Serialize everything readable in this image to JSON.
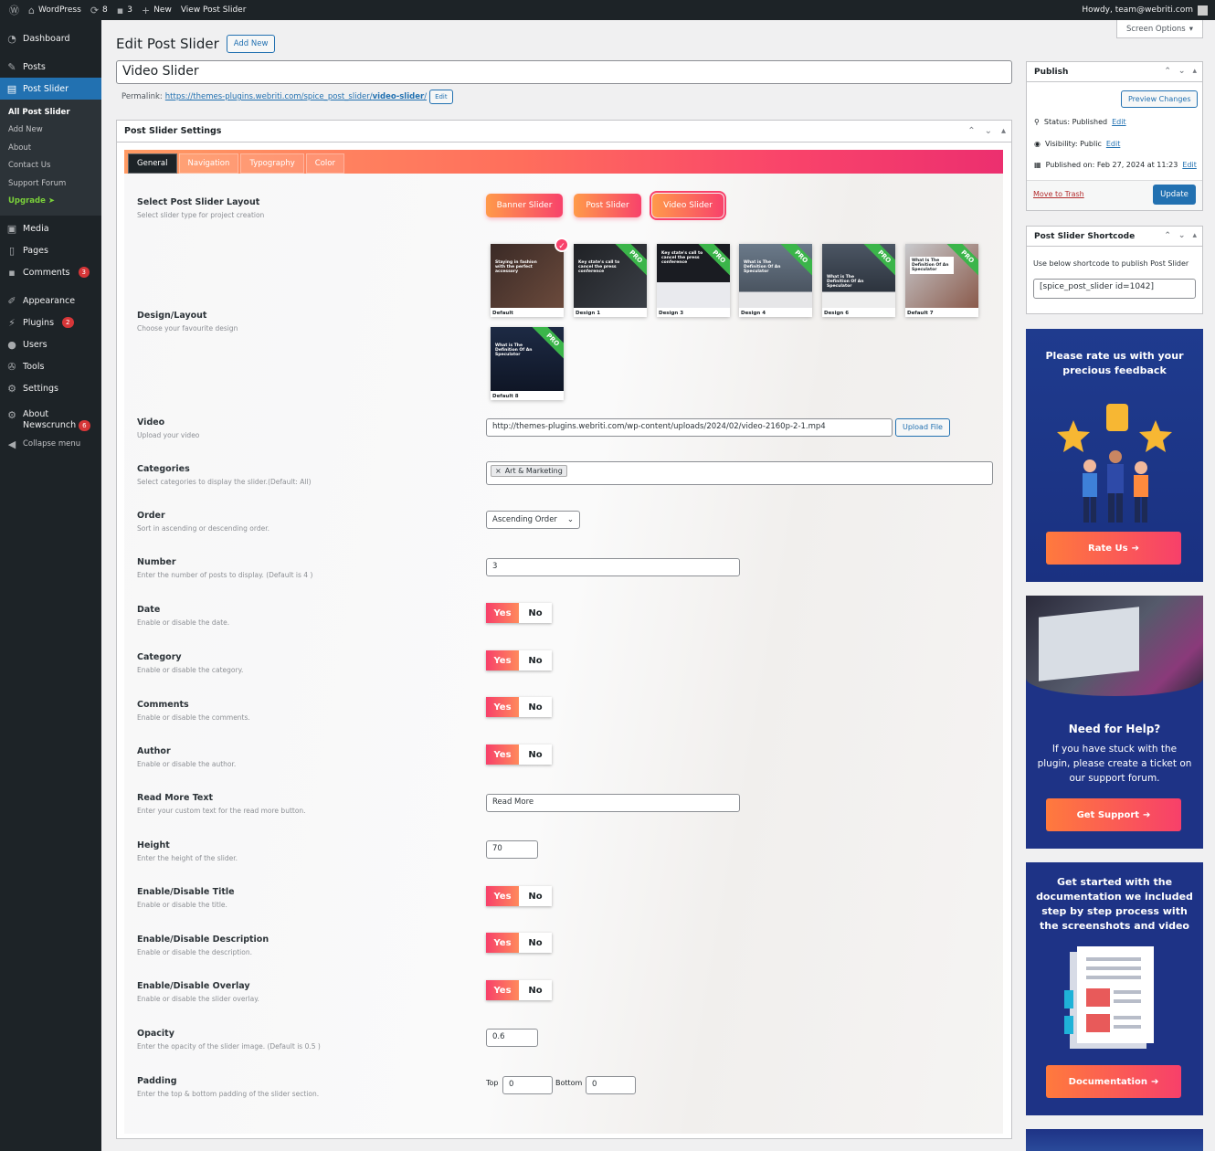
{
  "adminbar": {
    "site": "WordPress",
    "updates": "8",
    "comments": "3",
    "new": "New",
    "view": "View Post Slider",
    "howdy": "Howdy, team@webriti.com"
  },
  "sidebar": {
    "items": [
      {
        "label": "Dashboard",
        "icon": "dashboard-icon"
      },
      {
        "label": "Posts",
        "icon": "pin-icon"
      },
      {
        "label": "Post Slider",
        "icon": "slider-icon"
      },
      {
        "label": "Media",
        "icon": "media-icon"
      },
      {
        "label": "Pages",
        "icon": "page-icon"
      },
      {
        "label": "Comments",
        "icon": "comment-icon",
        "badge": "3"
      },
      {
        "label": "Appearance",
        "icon": "brush-icon"
      },
      {
        "label": "Plugins",
        "icon": "plug-icon",
        "badge": "2"
      },
      {
        "label": "Users",
        "icon": "user-icon"
      },
      {
        "label": "Tools",
        "icon": "wrench-icon"
      },
      {
        "label": "Settings",
        "icon": "settings-icon"
      },
      {
        "label": "About",
        "label2": "Newscrunch",
        "icon": "gear-icon",
        "badge": "6"
      },
      {
        "label": "Collapse menu",
        "icon": "collapse-icon"
      }
    ],
    "submenu": [
      "All Post Slider",
      "Add New",
      "About",
      "Contact Us",
      "Support Forum",
      "Upgrade"
    ]
  },
  "main": {
    "title": "Edit Post Slider",
    "add_new": "Add New",
    "post_title": "Video Slider",
    "permalink_label": "Permalink:",
    "permalink_base": "https://themes-plugins.webriti.com/spice_post_slider/",
    "permalink_slug": "video-slider",
    "permalink_end": "/",
    "edit": "Edit"
  },
  "settings": {
    "title": "Post Slider Settings",
    "tabs": [
      "General",
      "Navigation",
      "Typography",
      "Color"
    ],
    "layout": {
      "label": "Select Post Slider Layout",
      "desc": "Select slider type for project creation",
      "options": [
        "Banner Slider",
        "Post Slider",
        "Video Slider"
      ],
      "selected": "Video Slider"
    },
    "design": {
      "label": "Design/Layout",
      "desc": "Choose your favourite design",
      "thumbs": [
        {
          "caption": "Default",
          "pro": false,
          "selected": true,
          "text": "Staying in fashion with the perfect accessory"
        },
        {
          "caption": "Design 1",
          "pro": true,
          "selected": false,
          "text": "Key state's call to cancel the press conference"
        },
        {
          "caption": "Design 3",
          "pro": true,
          "selected": false,
          "text": "Key state's call to cancel the press conference"
        },
        {
          "caption": "Design 4",
          "pro": true,
          "selected": false,
          "text": "What is The Definition Of An Speculator"
        },
        {
          "caption": "Design 6",
          "pro": true,
          "selected": false,
          "text": "What is The Definition Of An Speculator"
        },
        {
          "caption": "Default 7",
          "pro": true,
          "selected": false,
          "text": "What Is The Definition Of An Speculator"
        },
        {
          "caption": "Default 8",
          "pro": true,
          "selected": false,
          "text": "What is The Definition Of An Speculator"
        }
      ],
      "pro_label": "PRO"
    },
    "video": {
      "label": "Video",
      "desc": "Upload your video",
      "value": "http://themes-plugins.webriti.com/wp-content/uploads/2024/02/video-2160p-2-1.mp4",
      "button": "Upload File"
    },
    "categories": {
      "label": "Categories",
      "desc": "Select categories to display the slider.(Default: All)",
      "tag": "Art & Marketing"
    },
    "order": {
      "label": "Order",
      "desc": "Sort in ascending or descending order.",
      "value": "Ascending Order"
    },
    "number": {
      "label": "Number",
      "desc": "Enter the number of posts to display. (Default is 4 )",
      "value": "3"
    },
    "date": {
      "label": "Date",
      "desc": "Enable or disable the date."
    },
    "category": {
      "label": "Category",
      "desc": "Enable or disable the category."
    },
    "comments": {
      "label": "Comments",
      "desc": "Enable or disable the comments."
    },
    "author": {
      "label": "Author",
      "desc": "Enable or disable the author."
    },
    "readmore": {
      "label": "Read More Text",
      "desc": "Enter your custom text for the read more button.",
      "value": "Read More"
    },
    "height": {
      "label": "Height",
      "desc": "Enter the height of the slider.",
      "value": "70"
    },
    "title_toggle": {
      "label": "Enable/Disable Title",
      "desc": "Enable or disable the title."
    },
    "desc_toggle": {
      "label": "Enable/Disable Description",
      "desc": "Enable or disable the description."
    },
    "overlay_toggle": {
      "label": "Enable/Disable Overlay",
      "desc": "Enable or disable the slider overlay."
    },
    "opacity": {
      "label": "Opacity",
      "desc": "Enter the opacity of the slider image. (Default is 0.5 )",
      "value": "0.6"
    },
    "padding": {
      "label": "Padding",
      "desc": "Enter the top & bottom padding of the slider section.",
      "top_label": "Top",
      "top": "0",
      "bottom_label": "Bottom",
      "bottom": "0"
    },
    "yes": "Yes",
    "no": "No"
  },
  "screen_options": "Screen Options",
  "publish": {
    "title": "Publish",
    "preview": "Preview Changes",
    "status": "Status: Published",
    "visibility": "Visibility: Public",
    "published_on": "Published on: Feb 27, 2024 at 11:23",
    "edit": "Edit",
    "trash": "Move to Trash",
    "update": "Update"
  },
  "shortcode": {
    "title": "Post Slider Shortcode",
    "desc": "Use below shortcode to publish Post Slider",
    "value": "[spice_post_slider id=1042]"
  },
  "banners": {
    "rate": {
      "text": "Please rate us with your precious feedback",
      "cta": "Rate Us"
    },
    "help": {
      "heading": "Need for Help?",
      "text": "If you have stuck with the plugin, please create a ticket on our support forum.",
      "cta": "Get Support"
    },
    "docs": {
      "text": "Get started with the documentation we included step by step process with the screenshots and video",
      "cta": "Documentation"
    }
  },
  "colors": {
    "accent": "#f8426b",
    "wp_blue": "#2271b1",
    "sidebar": "#1d2327"
  }
}
